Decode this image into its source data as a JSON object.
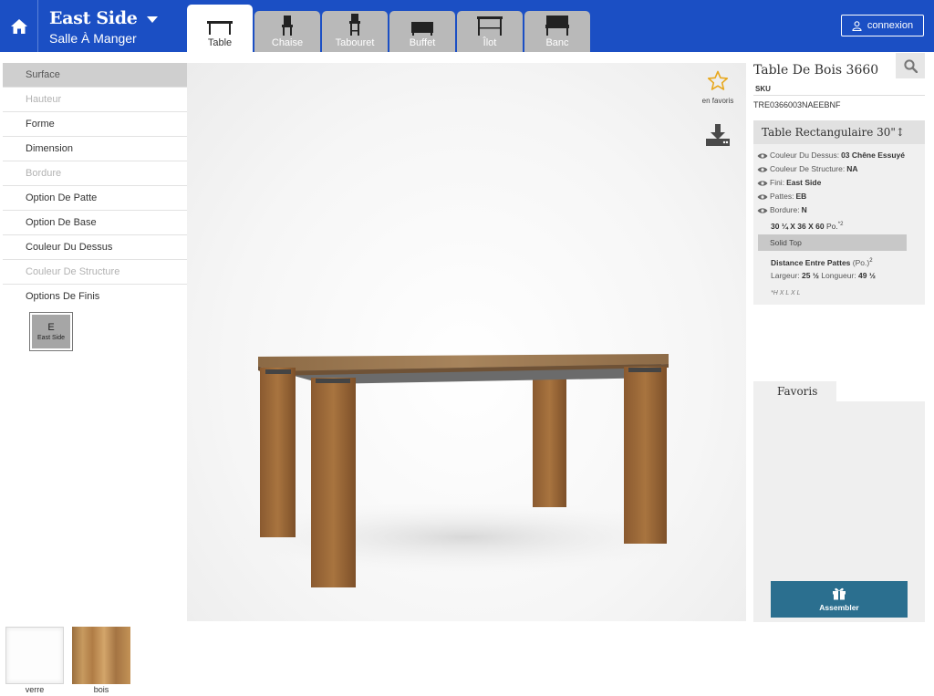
{
  "header": {
    "brand_title": "East Side",
    "brand_subtitle": "Salle À Manger",
    "login_label": "connexion",
    "tabs": [
      {
        "label": "Table",
        "icon": "table-icon",
        "active": true
      },
      {
        "label": "Chaise",
        "icon": "chair-icon",
        "active": false
      },
      {
        "label": "Tabouret",
        "icon": "stool-icon",
        "active": false
      },
      {
        "label": "Buffet",
        "icon": "buffet-icon",
        "active": false
      },
      {
        "label": "Îlot",
        "icon": "island-icon",
        "active": false
      },
      {
        "label": "Banc",
        "icon": "bench-icon",
        "active": false
      }
    ]
  },
  "menu": {
    "items": [
      {
        "label": "Surface",
        "state": "active"
      },
      {
        "label": "Hauteur",
        "state": "disabled"
      },
      {
        "label": "Forme",
        "state": "normal"
      },
      {
        "label": "Dimension",
        "state": "normal"
      },
      {
        "label": "Bordure",
        "state": "disabled"
      },
      {
        "label": "Option De Patte",
        "state": "normal"
      },
      {
        "label": "Option De Base",
        "state": "normal"
      },
      {
        "label": "Couleur Du Dessus",
        "state": "normal"
      },
      {
        "label": "Couleur De Structure",
        "state": "disabled"
      },
      {
        "label": "Options De Finis",
        "state": "normal"
      }
    ],
    "finish_swatch": {
      "letter": "E",
      "name": "East Side"
    }
  },
  "stage": {
    "favorite_label": "en favoris"
  },
  "product": {
    "title": "Table De Bois 3660",
    "sku_label": "SKU",
    "sku_value": "TRE0366003NAEEBNF",
    "spec_title": "Table Rectangulaire 30\"↕",
    "specs": [
      {
        "label": "Couleur Du Dessus:",
        "value": "03 Chêne Essuyé"
      },
      {
        "label": "Couleur De Structure:",
        "value": "NA"
      },
      {
        "label": "Fini:",
        "value": "East Side"
      },
      {
        "label": "Pattes:",
        "value": "EB"
      },
      {
        "label": "Bordure:",
        "value": "N"
      }
    ],
    "dimensions_value": "30 ¼ X 36 X 60",
    "dimensions_unit": "Po.",
    "dimensions_note": "*2",
    "solid_top": "Solid Top",
    "distance_label": "Distance Entre Pattes",
    "distance_unit": "(Po.)",
    "distance_note": "2",
    "width_label": "Largeur:",
    "width_value": "25 ½",
    "length_label": "Longueur:",
    "length_value": "49 ½",
    "dims_legend": "*H X L X L"
  },
  "favorites": {
    "tab_label": "Favoris",
    "assemble_label": "Assembler"
  },
  "materials": [
    {
      "label": "verre"
    },
    {
      "label": "bois"
    }
  ],
  "colors": {
    "header_blue": "#1b4fc4",
    "assemble_teal": "#2b6f8f",
    "star_gold": "#e8a81e"
  }
}
